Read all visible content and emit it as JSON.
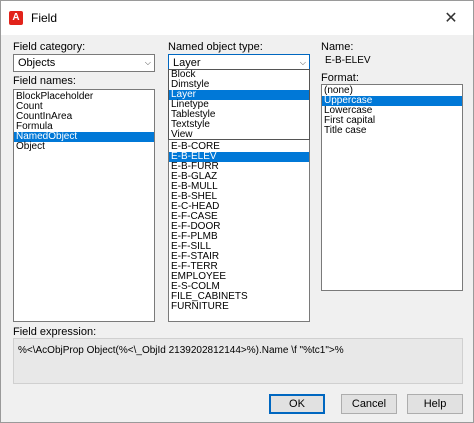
{
  "window": {
    "app_icon_letter": "A",
    "title": "Field",
    "close_glyph": "✕"
  },
  "field_category": {
    "label": "Field category:",
    "value": "Objects"
  },
  "field_names": {
    "label": "Field names:",
    "items": [
      "BlockPlaceholder",
      "Count",
      "CountInArea",
      "Formula",
      "NamedObject",
      "Object"
    ],
    "selected_index": 4
  },
  "named_object_type": {
    "label": "Named object type:",
    "value": "Layer",
    "options": [
      "Block",
      "Dimstyle",
      "Layer",
      "Linetype",
      "Tablestyle",
      "Textstyle",
      "View"
    ],
    "selected_index": 2
  },
  "names_list": {
    "items": [
      "E-B-CORE",
      "E-B-ELEV",
      "E-B-FURR",
      "E-B-GLAZ",
      "E-B-MULL",
      "E-B-SHEL",
      "E-C-HEAD",
      "E-F-CASE",
      "E-F-DOOR",
      "E-F-PLMB",
      "E-F-SILL",
      "E-F-STAIR",
      "E-F-TERR",
      "EMPLOYEE",
      "E-S-COLM",
      "FILE_CABINETS",
      "FURNITURE"
    ],
    "selected_index": 1
  },
  "name": {
    "label": "Name:",
    "value": "E-B-ELEV"
  },
  "format": {
    "label": "Format:",
    "items": [
      "(none)",
      "Uppercase",
      "Lowercase",
      "First capital",
      "Title case"
    ],
    "selected_index": 1
  },
  "field_expression": {
    "label": "Field expression:",
    "value": "%<\\AcObjProp Object(%<\\_ObjId 2139202812144>%).Name \\f \"%tc1\">%"
  },
  "buttons": {
    "ok": "OK",
    "cancel": "Cancel",
    "help": "Help"
  },
  "colors": {
    "selection": "#0078d7",
    "accent": "#0067c0",
    "app_icon": "#e2231a"
  }
}
